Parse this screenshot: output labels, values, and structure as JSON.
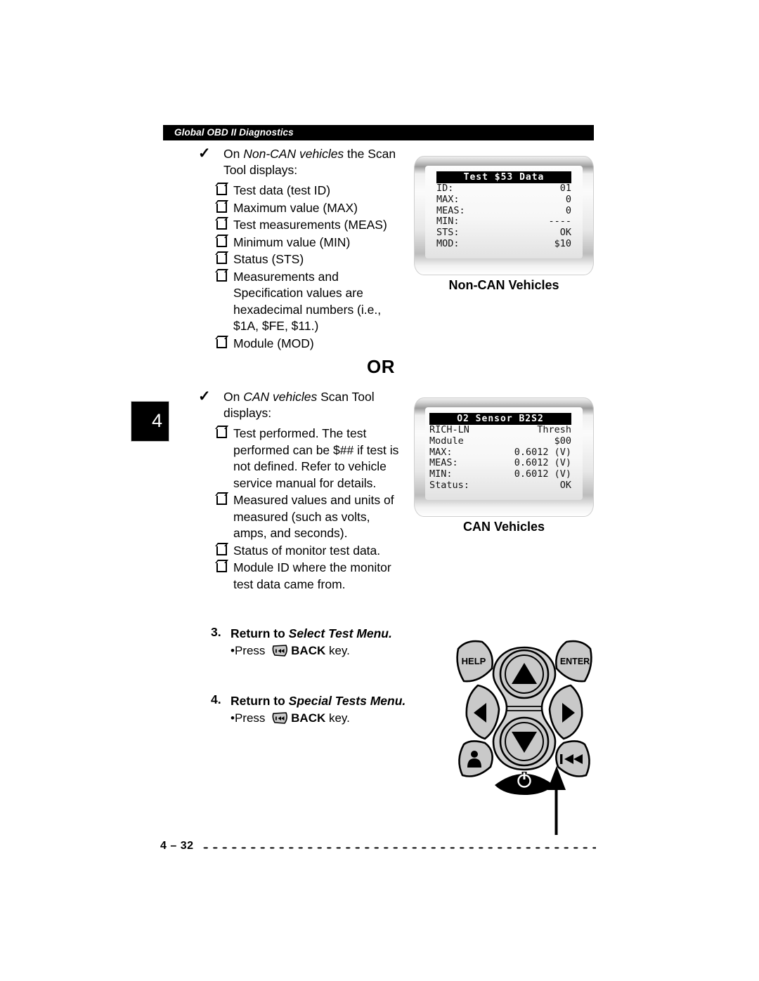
{
  "header": {
    "running_head": "Global OBD II Diagnostics"
  },
  "chapter_tab": {
    "number": "4"
  },
  "divider": {
    "or_label": "OR"
  },
  "section_noncan": {
    "check_icon": "checkmark-icon",
    "lead_parts": [
      "On ",
      "Non-CAN vehicles",
      " the Scan Tool displays:"
    ],
    "items": [
      "Test data (test ID)",
      "Maximum value (MAX)",
      "Test measurements (MEAS)",
      "Minimum value (MIN)",
      "Status (STS)",
      "Measurements and Specification values are hexadecimal numbers (i.e., $1A, $FE, $11.)",
      "Module (MOD)"
    ]
  },
  "section_can": {
    "check_icon": "checkmark-icon",
    "lead_parts": [
      "On ",
      "CAN vehicles",
      " Scan Tool displays:"
    ],
    "items": [
      "Test performed. The test performed can be $## if test is not defined. Refer to vehicle service manual for details.",
      "Measured values and units of measured (such as volts, amps, and seconds).",
      "Status of monitor test data.",
      "Module ID where the monitor test data came from."
    ]
  },
  "screens": [
    {
      "id": "non-can",
      "caption": "Non-CAN Vehicles",
      "title": "Test $53   Data",
      "rows": [
        {
          "label": "ID:",
          "value": "01"
        },
        {
          "label": "MAX:",
          "value": "0"
        },
        {
          "label": "MEAS:",
          "value": "0"
        },
        {
          "label": "MIN:",
          "value": "----"
        },
        {
          "label": "STS:",
          "value": "OK"
        },
        {
          "label": "MOD:",
          "value": "$10"
        }
      ]
    },
    {
      "id": "can",
      "caption": "CAN Vehicles",
      "title": "O2 Sensor B2S2",
      "rows": [
        {
          "label": "RICH-LN",
          "value": "Thresh"
        },
        {
          "label": "Module",
          "value": "$00"
        },
        {
          "label": "MAX:",
          "value": "0.6012 (V)"
        },
        {
          "label": "MEAS:",
          "value": "0.6012 (V)"
        },
        {
          "label": "MIN:",
          "value": "0.6012 (V)"
        },
        {
          "label": "Status:",
          "value": "OK"
        }
      ]
    }
  ],
  "steps": [
    {
      "number": "3.",
      "title_plain": "Return to ",
      "title_italic": "Select Test Menu.",
      "bullet": "•",
      "press_word": "Press ",
      "key_icon": "back-key-icon",
      "key_label": "BACK",
      "key_suffix": " key."
    },
    {
      "number": "4.",
      "title_plain": "Return to ",
      "title_italic": "Special Tests Menu.",
      "bullet": "•",
      "press_word": "Press ",
      "key_icon": "back-key-icon",
      "key_label": "BACK",
      "key_suffix": " key."
    }
  ],
  "keypad": {
    "help_label": "HELP",
    "enter_label": "ENTER",
    "up_icon": "up-arrow-icon",
    "down_icon": "down-arrow-icon",
    "left_icon": "left-arrow-icon",
    "right_icon": "right-arrow-icon",
    "user_icon": "person-icon",
    "back_icon": "rewind-back-icon",
    "power_icon": "power-icon",
    "callout_icon": "callout-arrow-icon",
    "fill_color": "#c9c9c9",
    "power_fill": "#000000"
  },
  "footer": {
    "page_number": "4 – 32"
  }
}
